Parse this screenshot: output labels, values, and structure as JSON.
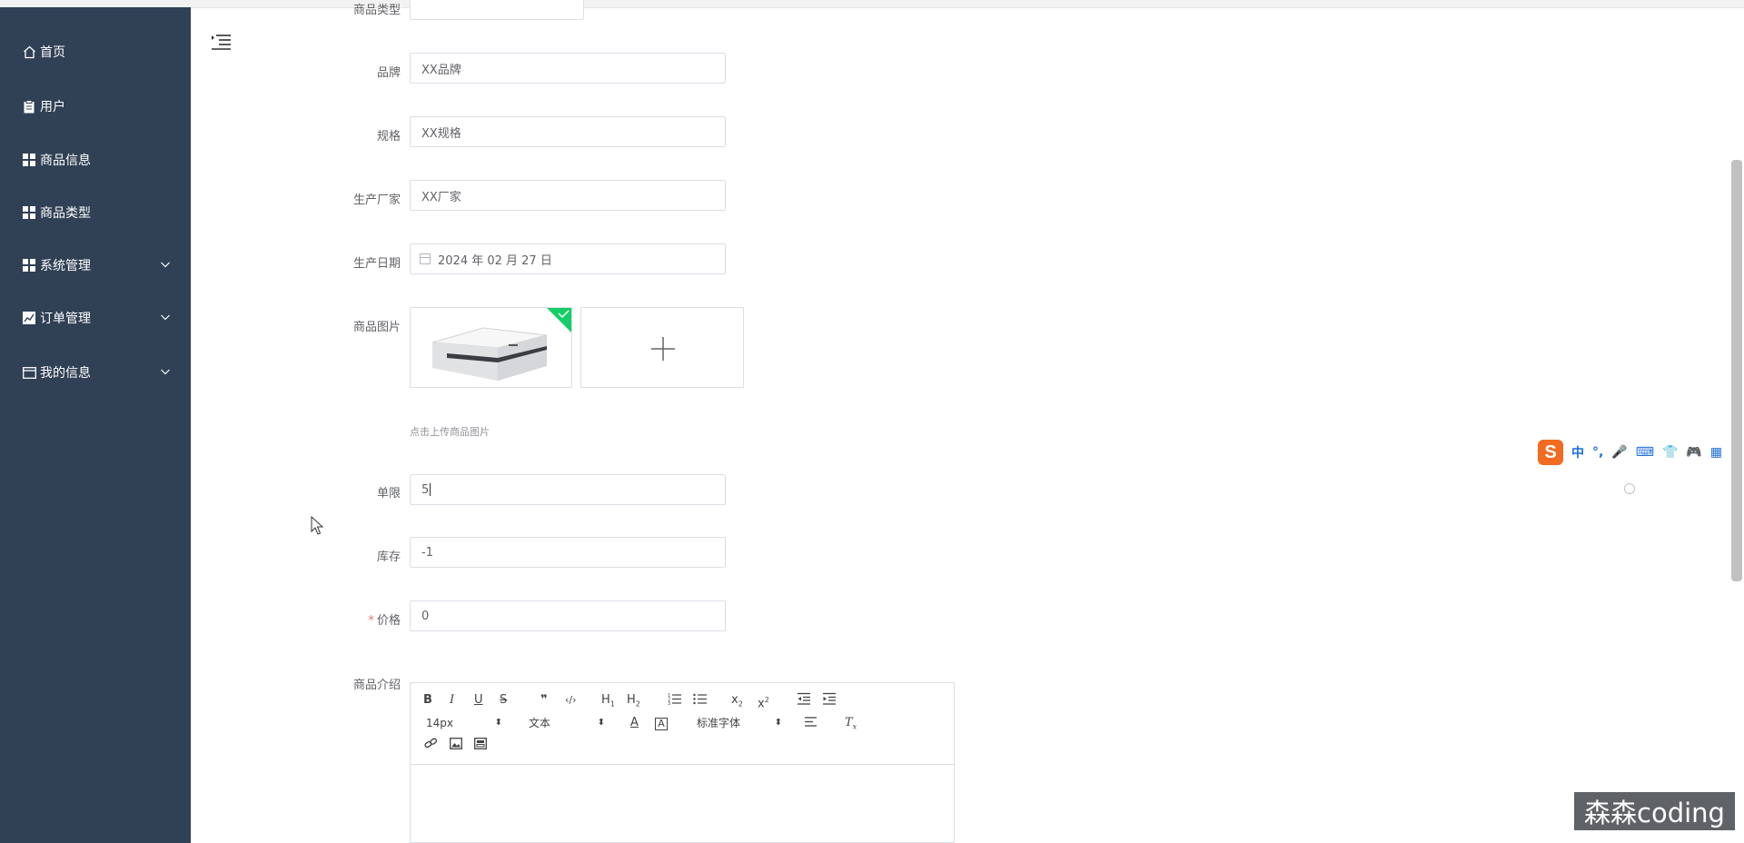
{
  "sidebar": {
    "items": [
      {
        "label": "首页",
        "icon": "home-icon"
      },
      {
        "label": "用户",
        "icon": "clipboard-icon"
      },
      {
        "label": "商品信息",
        "icon": "grid-icon"
      },
      {
        "label": "商品类型",
        "icon": "grid-icon"
      },
      {
        "label": "系统管理",
        "icon": "grid-icon",
        "expandable": true
      },
      {
        "label": "订单管理",
        "icon": "chart-icon",
        "expandable": true
      },
      {
        "label": "我的信息",
        "icon": "card-icon",
        "expandable": true
      }
    ]
  },
  "form": {
    "type_label": "商品类型",
    "brand_label": "品牌",
    "brand_value": "XX品牌",
    "spec_label": "规格",
    "spec_value": "XX规格",
    "maker_label": "生产厂家",
    "maker_value": "XX厂家",
    "date_label": "生产日期",
    "date_value": "2024 年 02 月 27 日",
    "image_label": "商品图片",
    "upload_tip": "点击上传商品图片",
    "limit_label": "单限",
    "limit_value": "5",
    "stock_label": "库存",
    "stock_value": "-1",
    "price_required_mark": "*",
    "price_label": "价格",
    "price_value": "0",
    "intro_label": "商品介绍"
  },
  "editor": {
    "font_size": "14px",
    "paragraph": "文本",
    "font_family": "标准字体"
  },
  "ime": {
    "logo": "S",
    "items": [
      "中",
      "°,",
      "🎤",
      "⌨",
      "👕",
      "🎮",
      "▦",
      "⚙"
    ]
  },
  "watermark": "森森coding",
  "colors": {
    "sidebar_bg": "#304156",
    "accent_badge": "#13ce66",
    "required": "#f56c6c",
    "ime_orange": "#f26b21",
    "ime_blue": "#1e6fd9"
  }
}
